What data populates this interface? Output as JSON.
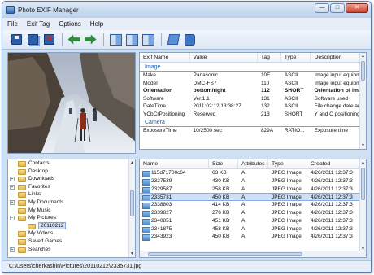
{
  "app": {
    "title": "Photo EXIF Manager",
    "window_buttons": {
      "minimize": "—",
      "maximize": "□",
      "close": "✕"
    }
  },
  "menu": [
    "File",
    "Exif Tag",
    "Options",
    "Help"
  ],
  "toolbar": {
    "buttons": [
      {
        "icon": "save-icon"
      },
      {
        "icon": "save-all-icon"
      },
      {
        "icon": "delete-exif-icon"
      },
      {
        "icon": "rotate-left-icon"
      },
      {
        "icon": "rotate-right-icon"
      },
      {
        "icon": "flip-horizontal-icon"
      },
      {
        "icon": "flip-vertical-icon"
      },
      {
        "icon": "flip-both-icon"
      },
      {
        "icon": "edit-icon"
      },
      {
        "icon": "help-book-icon"
      }
    ]
  },
  "exif": {
    "columns": [
      "Exif Name",
      "Value",
      "Tag",
      "Type",
      "Description"
    ],
    "groups": [
      {
        "name": "Image",
        "rows": [
          {
            "name": "Make",
            "value": "Panasonic",
            "tag": "10F",
            "type": "ASCII",
            "desc": "Image input equipm",
            "bold": false
          },
          {
            "name": "Model",
            "value": "DMC-FS7",
            "tag": "110",
            "type": "ASCII",
            "desc": "Image input equipm",
            "bold": false
          },
          {
            "name": "Orientation",
            "value": "bottom/right",
            "tag": "112",
            "type": "SHORT",
            "desc": "Orientation of ima",
            "bold": true
          },
          {
            "name": "Software",
            "value": "Ver.1.1",
            "tag": "131",
            "type": "ASCII",
            "desc": "Software used",
            "bold": false
          },
          {
            "name": "DateTime",
            "value": "2011:02:12 13:38:27",
            "tag": "132",
            "type": "ASCII",
            "desc": "File change date ar",
            "bold": false
          },
          {
            "name": "YCbCrPositioning",
            "value": "Reserved",
            "tag": "213",
            "type": "SHORT",
            "desc": "Y and C positioning",
            "bold": false
          }
        ]
      },
      {
        "name": "Camera",
        "rows": [
          {
            "name": "ExposureTime",
            "value": "10/2500 sec",
            "tag": "829A",
            "type": "RATIO...",
            "desc": "Exposure time",
            "bold": false
          }
        ]
      }
    ]
  },
  "tree": [
    {
      "label": "Contacts",
      "indent": 1,
      "exp": ""
    },
    {
      "label": "Desktop",
      "indent": 1,
      "exp": ""
    },
    {
      "label": "Downloads",
      "indent": 1,
      "exp": "+"
    },
    {
      "label": "Favorites",
      "indent": 1,
      "exp": "+"
    },
    {
      "label": "Links",
      "indent": 1,
      "exp": ""
    },
    {
      "label": "My Documents",
      "indent": 1,
      "exp": "+"
    },
    {
      "label": "My Music",
      "indent": 1,
      "exp": ""
    },
    {
      "label": "My Pictures",
      "indent": 1,
      "exp": "−"
    },
    {
      "label": "20110212",
      "indent": 2,
      "exp": "",
      "selected": true
    },
    {
      "label": "My Videos",
      "indent": 1,
      "exp": ""
    },
    {
      "label": "Saved Games",
      "indent": 1,
      "exp": ""
    },
    {
      "label": "Searches",
      "indent": 1,
      "exp": "+"
    }
  ],
  "files": {
    "columns": [
      "Name",
      "Size",
      "Attributes",
      "Type",
      "Created"
    ],
    "rows": [
      {
        "name": "115d71700c64",
        "size": "63 KB",
        "attr": "A",
        "type": "JPEG Image",
        "created": "4/26/2011 12:37:3",
        "selected": false
      },
      {
        "name": "2327539",
        "size": "430 KB",
        "attr": "A",
        "type": "JPEG Image",
        "created": "4/26/2011 12:37:3",
        "selected": false
      },
      {
        "name": "2329587",
        "size": "258 KB",
        "attr": "A",
        "type": "JPEG Image",
        "created": "4/26/2011 12:37:3",
        "selected": false
      },
      {
        "name": "2335731",
        "size": "450 KB",
        "attr": "A",
        "type": "JPEG Image",
        "created": "4/26/2011 12:37:3",
        "selected": true
      },
      {
        "name": "2338803",
        "size": "414 KB",
        "attr": "A",
        "type": "JPEG Image",
        "created": "4/26/2011 12:37:3",
        "selected": false
      },
      {
        "name": "2339827",
        "size": "276 KB",
        "attr": "A",
        "type": "JPEG Image",
        "created": "4/26/2011 12:37:3",
        "selected": false
      },
      {
        "name": "2340851",
        "size": "451 KB",
        "attr": "A",
        "type": "JPEG Image",
        "created": "4/26/2011 12:37:3",
        "selected": false
      },
      {
        "name": "2341875",
        "size": "458 KB",
        "attr": "A",
        "type": "JPEG Image",
        "created": "4/26/2011 12:37:3",
        "selected": false
      },
      {
        "name": "2343923",
        "size": "450 KB",
        "attr": "A",
        "type": "JPEG Image",
        "created": "4/26/2011 12:37:3",
        "selected": false
      }
    ]
  },
  "status": {
    "path": "C:\\Users\\cherkashin\\Pictures\\20110212\\2335731.jpg"
  },
  "colors": {
    "accent": "#1d5fb0",
    "selection": "#cde0f6",
    "chrome": "#cfe0f3"
  }
}
